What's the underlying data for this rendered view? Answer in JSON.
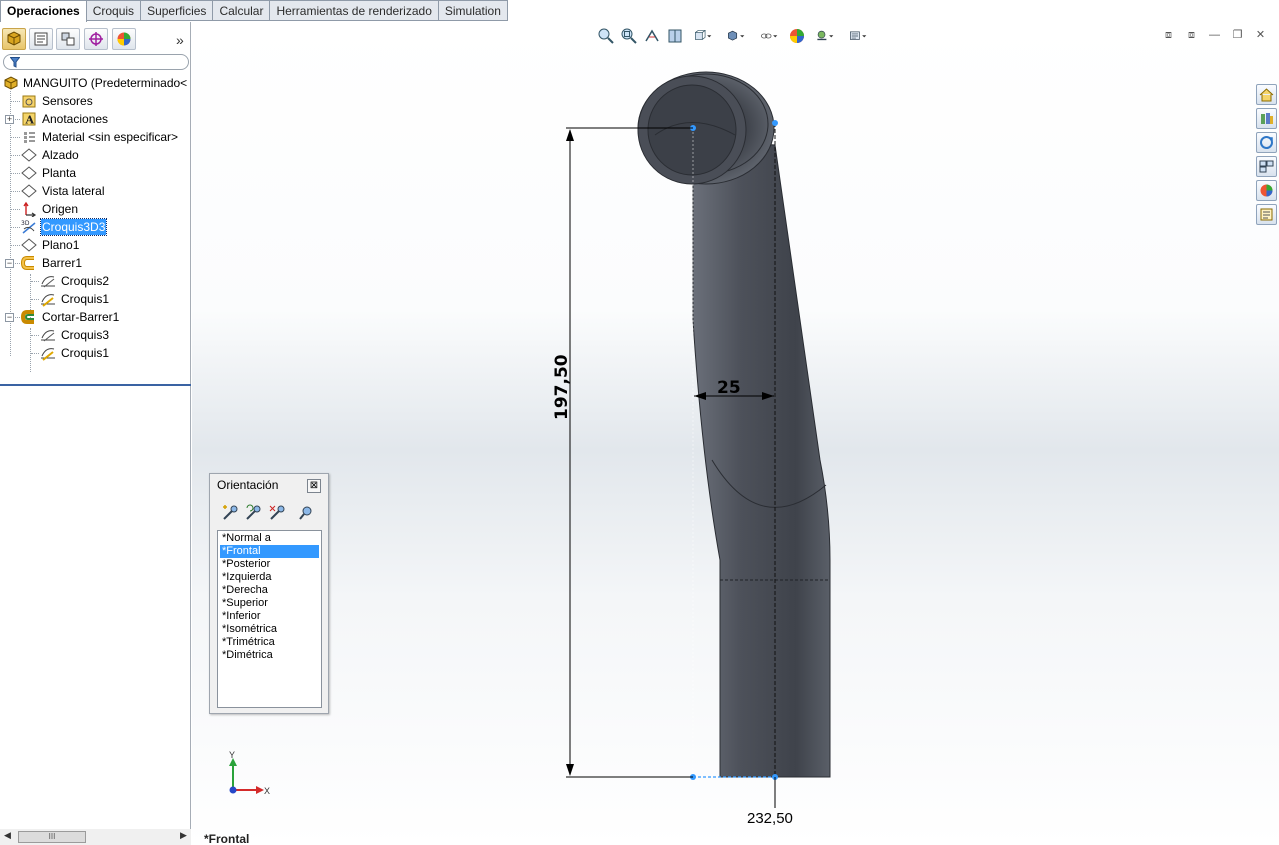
{
  "command_tabs": [
    "Operaciones",
    "Croquis",
    "Superficies",
    "Calcular",
    "Herramientas de renderizado",
    "Simulation"
  ],
  "active_tab": "Operaciones",
  "feature_tree": {
    "root": "MANGUITO  (Predeterminado<",
    "items": [
      {
        "label": "Sensores",
        "icon": "sensor-folder-icon"
      },
      {
        "label": "Anotaciones",
        "icon": "annotations-icon"
      },
      {
        "label": "Material <sin especificar>",
        "icon": "material-icon"
      },
      {
        "label": "Alzado",
        "icon": "plane-icon"
      },
      {
        "label": "Planta",
        "icon": "plane-icon"
      },
      {
        "label": "Vista lateral",
        "icon": "plane-icon"
      },
      {
        "label": "Origen",
        "icon": "origin-icon"
      },
      {
        "label": "Croquis3D3",
        "icon": "sketch3d-icon"
      },
      {
        "label": "Plano1",
        "icon": "plane-icon"
      },
      {
        "label": "Barrer1",
        "icon": "sweep-icon"
      },
      {
        "label": "Croquis2",
        "icon": "sketch-icon"
      },
      {
        "label": "Croquis1",
        "icon": "sketch-icon"
      },
      {
        "label": "Cortar-Barrer1",
        "icon": "cut-sweep-icon"
      },
      {
        "label": "Croquis3",
        "icon": "sketch-icon"
      },
      {
        "label": "Croquis1",
        "icon": "sketch-icon"
      }
    ],
    "selected": "Croquis3D3"
  },
  "scrollbar_thumb": "III",
  "orientation": {
    "title": "Orientación",
    "close": "x",
    "views": [
      "*Normal a",
      "*Frontal",
      "*Posterior",
      "*Izquierda",
      "*Derecha",
      "*Superior",
      "*Inferior",
      "*Isométrica",
      "*Trimétrica",
      "*Dimétrica"
    ],
    "selected": "*Frontal"
  },
  "dimensions": {
    "height": "197,50",
    "width": "25",
    "offset": "232,50"
  },
  "triad": {
    "y": "Y",
    "x": "X"
  },
  "view_name": "*Frontal",
  "colors": {
    "selection": "#3399ff",
    "part_body": "#4f535c",
    "dimension_line": "#000000",
    "sketch_point": "#3399ff"
  }
}
